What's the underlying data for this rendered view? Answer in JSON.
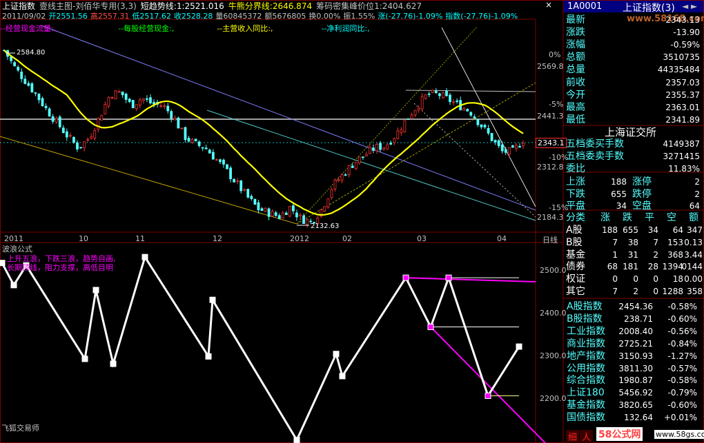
{
  "header": {
    "line1": [
      {
        "text": "上证指数",
        "color": "#ffffff"
      },
      {
        "text": "壹线主图-刘佰华专用(3,3)",
        "color": "#c0c0c0"
      },
      {
        "text": "短趋势线:1:2521.016",
        "color": "#ffffff"
      },
      {
        "text": "牛熊分界线:2646.874",
        "color": "#ffff00"
      },
      {
        "text": "筹码密集峰价位1:2404.627",
        "color": "#c0c0c0"
      }
    ],
    "line2": [
      {
        "text": "2011/09/02",
        "color": "#c0c0c0"
      },
      {
        "text": "开2551.56",
        "color": "#00ffff"
      },
      {
        "text": "高2557.31",
        "color": "#ff5050"
      },
      {
        "text": "低2517.62",
        "color": "#00ffff"
      },
      {
        "text": "收2528.28",
        "color": "#00ffff"
      },
      {
        "text": "量60845372",
        "color": "#c0c0c0"
      },
      {
        "text": "额5676805",
        "color": "#c0c0c0"
      },
      {
        "text": "换0.00%",
        "color": "#c0c0c0"
      },
      {
        "text": "振1.55%",
        "color": "#c0c0c0"
      },
      {
        "text": "涨(-27.76)-1.09%",
        "color": "#00ffff"
      },
      {
        "text": "指数(-27.76)-1.09%",
        "color": "#00ffff"
      }
    ],
    "line3": [
      {
        "text": "--经营现金流量:,",
        "color": "#ff00ff"
      },
      {
        "text": "--每股经营现金:,",
        "color": "#00ff00"
      },
      {
        "text": "--主营收入同比:,",
        "color": "#ffff00"
      },
      {
        "text": "--净利润同比:,",
        "color": "#00ffff"
      }
    ],
    "close_x": "×"
  },
  "main_chart": {
    "right_axis": [
      {
        "text": "0%",
        "color": "#c0c0c0"
      },
      {
        "text": "2569.8",
        "color": "#c0c0c0"
      },
      {
        "text": "-5%",
        "color": "#c0c0c0"
      },
      {
        "text": "2441.3",
        "color": "#c0c0c0"
      },
      {
        "text": "2343.1",
        "color": "#ffffff"
      },
      {
        "text": "-10%",
        "color": "#c0c0c0"
      },
      {
        "text": "2312.8",
        "color": "#c0c0c0"
      },
      {
        "text": "-15%",
        "color": "#c0c0c0"
      },
      {
        "text": "2184.3",
        "color": "#c0c0c0"
      }
    ],
    "annotations": [
      {
        "text": "2584.80"
      },
      {
        "text": "2132.63"
      }
    ],
    "x_axis": [
      "2011",
      "10",
      "11",
      "12",
      "2012",
      "02",
      "03",
      "04"
    ],
    "period": "日线"
  },
  "wave_panel": {
    "title": "波浪公式",
    "legend": [
      "上升五浪，下跌三浪，趋势自画,",
      "长期顶线，阻力支撑，高低目明"
    ],
    "y_axis": [
      "2500.0",
      "2400.0",
      "2300.0",
      "2200.0"
    ],
    "watermark": "飞狐交易师"
  },
  "chart_data": [
    {
      "type": "line",
      "title": "上证指数 日线",
      "x": [
        "2011",
        "10",
        "11",
        "12",
        "2012",
        "02",
        "03",
        "04"
      ],
      "ylim": [
        2132.63,
        2584.8
      ],
      "annotations": [
        {
          "text": "2584.80",
          "value": 2584.8
        },
        {
          "text": "2132.63",
          "value": 2132.63
        }
      ],
      "series": [
        {
          "name": "close",
          "values": [
            2584.8,
            2540,
            2505,
            2470,
            2430,
            2395,
            2360,
            2330,
            2355,
            2410,
            2470,
            2475,
            2440,
            2460,
            2445,
            2440,
            2410,
            2360,
            2340,
            2330,
            2300,
            2270,
            2235,
            2200,
            2170,
            2160,
            2150,
            2175,
            2145,
            2135,
            2170,
            2230,
            2260,
            2290,
            2310,
            2330,
            2335,
            2365,
            2405,
            2440,
            2470,
            2470,
            2455,
            2440,
            2425,
            2390,
            2355,
            2320,
            2320,
            2350
          ]
        }
      ]
    },
    {
      "type": "line",
      "title": "波浪公式",
      "ylim": [
        2170,
        2530
      ],
      "series": [
        {
          "name": "wave",
          "values": [
            2515,
            2470,
            2510,
            2320,
            2460,
            2310,
            2527,
            2325,
            2440,
            2155,
            2330,
            2285,
            2485,
            2385,
            2485,
            2245,
            2345
          ]
        }
      ]
    }
  ],
  "right_panel": {
    "header": {
      "code": "1A0001",
      "name": "上证指数(3)",
      "nav": "◄ ►"
    },
    "watermark": "www.58168.com",
    "quote": [
      {
        "label": "最新",
        "value": "2343.13",
        "color": "#ffffff"
      },
      {
        "label": "涨跌",
        "value": "-13.90",
        "color": "#ffffff"
      },
      {
        "label": "涨幅",
        "value": "-0.59%",
        "color": "#ffffff"
      },
      {
        "label": "总额",
        "value": "3510735",
        "color": "#ffffff"
      },
      {
        "label": "总量",
        "value": "44335484",
        "color": "#ffffff"
      },
      {
        "label": "前收",
        "value": "2357.03",
        "color": "#ffffff"
      },
      {
        "label": "今开",
        "value": "2355.37",
        "color": "#ffffff"
      },
      {
        "label": "最高",
        "value": "2363.01",
        "color": "#ffffff"
      },
      {
        "label": "最低",
        "value": "2341.89",
        "color": "#ffffff"
      }
    ],
    "exchange_title": "上海证交所",
    "orders": [
      {
        "label": "五档委买手数",
        "value": "4149387"
      },
      {
        "label": "五档委卖手数",
        "value": "3271415"
      },
      {
        "label": "委比",
        "value": "11.83%"
      }
    ],
    "breadth": [
      {
        "l1": "上涨",
        "v1": "188",
        "l2": "涨停",
        "v2": "2"
      },
      {
        "l1": "下跌",
        "v1": "655",
        "l2": "跌停",
        "v2": "2"
      },
      {
        "l1": "平盘",
        "v1": "34",
        "l2": "空盘",
        "v2": "64"
      }
    ],
    "table_headers": [
      "分类",
      "涨",
      "跌",
      "平",
      "空",
      "额"
    ],
    "table_rows": [
      {
        "name": "A股",
        "up": "188",
        "down": "655",
        "flat": "34",
        "empty": "64",
        "amt": "347"
      },
      {
        "name": "B股",
        "up": "7",
        "down": "38",
        "flat": "7",
        "empty": "153",
        "amt": "0.13"
      },
      {
        "name": "基金",
        "up": "1",
        "down": "31",
        "flat": "2",
        "empty": "368",
        "amt": "3.44"
      },
      {
        "name": "债券",
        "up": "68",
        "down": "181",
        "flat": "28",
        "empty": "1394",
        "amt": "0144"
      },
      {
        "name": "权证",
        "up": "0",
        "down": "0",
        "flat": "0",
        "empty": "18",
        "amt": "0.00"
      },
      {
        "name": "其它",
        "up": "7",
        "down": "2",
        "flat": "0",
        "empty": "1288",
        "amt": "358"
      }
    ],
    "indices": [
      {
        "name": "A股指数",
        "value": "2454.36",
        "pct": "-0.58%"
      },
      {
        "name": "B股指数",
        "value": "238.71",
        "pct": "-0.60%"
      },
      {
        "name": "工业指数",
        "value": "2008.40",
        "pct": "-0.56%"
      },
      {
        "name": "商业指数",
        "value": "2725.21",
        "pct": "-0.84%"
      },
      {
        "name": "地产指数",
        "value": "3150.93",
        "pct": "-1.27%"
      },
      {
        "name": "公用指数",
        "value": "3811.30",
        "pct": "-0.57%"
      },
      {
        "name": "综合指数",
        "value": "1980.87",
        "pct": "-0.58%"
      },
      {
        "name": "上证180",
        "value": "5456.92",
        "pct": "-0.79%"
      },
      {
        "name": "基金指数",
        "value": "3820.65",
        "pct": "-0.60%"
      },
      {
        "name": "国债指数",
        "value": "132.64",
        "pct": "+0.01%"
      }
    ],
    "footer_tabs": [
      "细",
      "人"
    ],
    "footer_logo": "58公式网",
    "footer_url": "www.58gs.com"
  },
  "colors": {
    "up": "#ff3232",
    "down": "#54ffff",
    "ma": "#ffff00",
    "wave": "#ffffff",
    "magenta": "#ff00ff",
    "grid": "#7f0000"
  }
}
